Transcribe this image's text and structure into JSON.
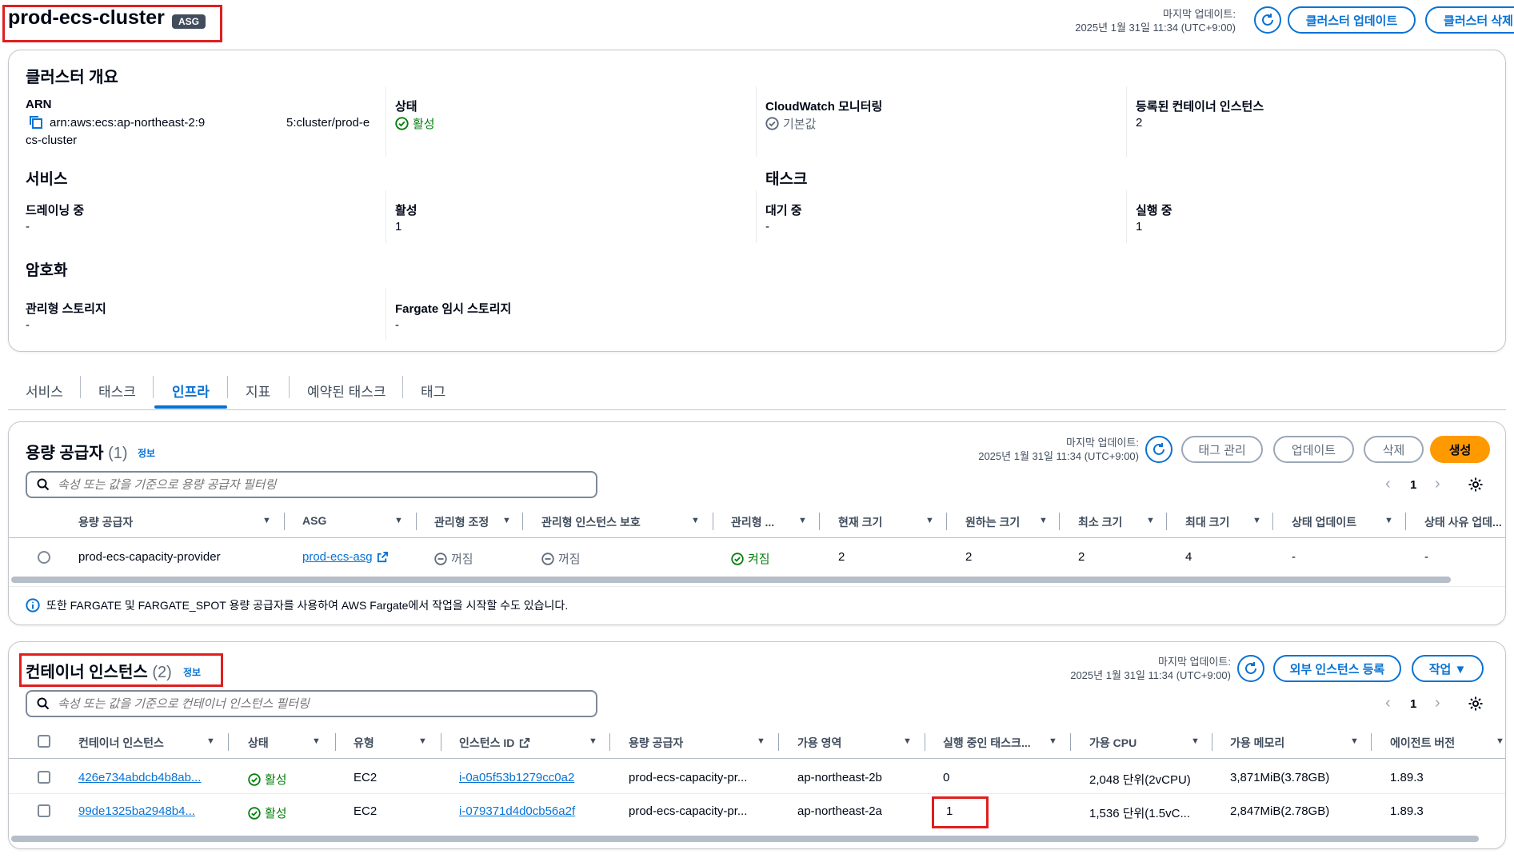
{
  "header": {
    "title": "prod-ecs-cluster",
    "badge": "ASG",
    "last_updated_label": "마지막 업데이트:",
    "last_updated_value": "2025년 1월 31일 11:34 (UTC+9:00)",
    "update_button": "클러스터 업데이트",
    "delete_button": "클러스터 삭제"
  },
  "overview": {
    "title": "클러스터 개요",
    "arn_label": "ARN",
    "arn_value_line1": "arn:aws:ecs:ap-northeast-2:9",
    "arn_value_line1b": "5:cluster/prod-e",
    "arn_value_line2": "cs-cluster",
    "status_label": "상태",
    "status_value": "활성",
    "cloudwatch_label": "CloudWatch 모니터링",
    "cloudwatch_value": "기본값",
    "registered_label": "등록된 컨테이너 인스턴스",
    "registered_value": "2",
    "services_title": "서비스",
    "draining_label": "드레이닝 중",
    "draining_value": "-",
    "active_label": "활성",
    "active_value": "1",
    "tasks_title": "태스크",
    "pending_label": "대기 중",
    "pending_value": "-",
    "running_label": "실행 중",
    "running_value": "1",
    "encryption_title": "암호화",
    "managed_storage_label": "관리형 스토리지",
    "managed_storage_value": "-",
    "fargate_storage_label": "Fargate 임시 스토리지",
    "fargate_storage_value": "-"
  },
  "tabs": [
    "서비스",
    "태스크",
    "인프라",
    "지표",
    "예약된 태스크",
    "태그"
  ],
  "capacity": {
    "title": "용량 공급자",
    "count": "(1)",
    "info": "정보",
    "last_updated_label": "마지막 업데이트:",
    "last_updated_value": "2025년 1월 31일 11:34 (UTC+9:00)",
    "tag_button": "태그 관리",
    "update_button": "업데이트",
    "delete_button": "삭제",
    "create_button": "생성",
    "search_placeholder": "속성 또는 값을 기준으로 용량 공급자 필터링",
    "page": "1",
    "columns": [
      "용량 공급자",
      "ASG",
      "관리형 조정",
      "관리형 인스턴스 보호",
      "관리형 ...",
      "현재 크기",
      "원하는 크기",
      "최소 크기",
      "최대 크기",
      "상태 업데이트",
      "상태 사유 업데..."
    ],
    "row": {
      "name": "prod-ecs-capacity-provider",
      "asg": "prod-ecs-asg",
      "managed_scaling": "꺼짐",
      "instance_protection": "꺼짐",
      "managed_termination": "켜짐",
      "current": "2",
      "desired": "2",
      "min": "2",
      "max": "4",
      "status_update": "-",
      "status_reason": "-"
    },
    "notice": "또한 FARGATE 및 FARGATE_SPOT 용량 공급자를 사용하여 AWS Fargate에서 작업을 시작할 수도 있습니다."
  },
  "instances": {
    "title": "컨테이너 인스턴스",
    "count": "(2)",
    "info": "정보",
    "last_updated_label": "마지막 업데이트:",
    "last_updated_value": "2025년 1월 31일 11:34 (UTC+9:00)",
    "register_button": "외부 인스턴스 등록",
    "actions_button": "작업 ▼",
    "search_placeholder": "속성 또는 값을 기준으로 컨테이너 인스턴스 필터링",
    "page": "1",
    "columns": [
      "컨테이너 인스턴스",
      "상태",
      "유형",
      "인스턴스 ID",
      "용량 공급자",
      "가용 영역",
      "실행 중인 태스크...",
      "가용 CPU",
      "가용 메모리",
      "에이전트 버전"
    ],
    "rows": [
      {
        "id": "426e734abdcb4b8ab...",
        "status": "활성",
        "type": "EC2",
        "instance_id": "i-0a05f53b1279cc0a2",
        "provider": "prod-ecs-capacity-pr...",
        "az": "ap-northeast-2b",
        "running": "0",
        "cpu": "2,048 단위(2vCPU)",
        "memory": "3,871MiB(3.78GB)",
        "agent": "1.89.3"
      },
      {
        "id": "99de1325ba2948b4...",
        "status": "활성",
        "type": "EC2",
        "instance_id": "i-079371d4d0cb56a2f",
        "provider": "prod-ecs-capacity-pr...",
        "az": "ap-northeast-2a",
        "running": "1",
        "cpu": "1,536 단위(1.5vC...",
        "memory": "2,847MiB(2.78GB)",
        "agent": "1.89.3"
      }
    ]
  },
  "colors": {
    "accent": "#0972d3",
    "success": "#037f0c",
    "create": "#ff9900",
    "highlight": "#e01e1e"
  }
}
